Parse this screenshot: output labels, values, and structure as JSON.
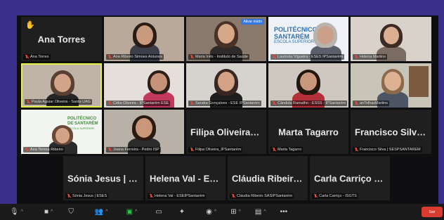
{
  "tiles": [
    {
      "key": "ana",
      "name": "Ana Torres",
      "label": "Ana Torres",
      "raised_hand": true
    },
    {
      "key": "p2",
      "label": "Ana Ribeiro Simoes Antunes"
    },
    {
      "key": "p3",
      "label": "Maria Inês - Instituto de Saúde",
      "tag": "Ativar modo"
    },
    {
      "key": "p4",
      "label": "Laurinda Vigueira - ESES IPSantarém",
      "logo_text": [
        "POLITÉCNICO",
        "SANTARÉM"
      ],
      "logo_small": "ESCOLA SUPERIOR"
    },
    {
      "key": "p5",
      "label": "Helena Martins"
    },
    {
      "key": "p6",
      "label": "Paula Aguiar Oliveira - Santa UAG",
      "active": true
    },
    {
      "key": "p7",
      "label": "Célia Oliveira - IPSantarém ESE"
    },
    {
      "key": "p8",
      "label": "Sandra Gonçalves - ESE IPSantarém"
    },
    {
      "key": "p9",
      "label": "Cândida Ramalho - ESSS - IPSantarém"
    },
    {
      "key": "p10",
      "label": "anTolhasMartins"
    },
    {
      "key": "p11",
      "label": "Ana Teresa Ribeiro",
      "logo_text": [
        "POLITÉCNICO",
        "DE SANTARÉM"
      ],
      "logo_small": "ESCOLA SUPERIOR"
    },
    {
      "key": "p12",
      "label": "Joana Ferreira - Pedro ISP"
    },
    {
      "key": "filipa",
      "name": "Filipa Oliveira_I...",
      "label": "Filipa Oliveira_IPSantarém"
    },
    {
      "key": "marta",
      "name": "Marta Tagarro",
      "label": "Marta Tagarro"
    },
    {
      "key": "francisco",
      "name": "Francisco Silva...",
      "label": "Francisco Silva | SESPSANTAREM"
    },
    {
      "key": "sonia",
      "name": "Sónia Jesus | ESES",
      "label": "Sónia Jesus | ESES"
    },
    {
      "key": "helena",
      "name": "Helena Val - ES...",
      "label": "Helena Val - ESEIPSantarém"
    },
    {
      "key": "claudia",
      "name": "Cláudia Ribeiro...",
      "label": "Cláudia Ribeiro SASIPSantarém"
    },
    {
      "key": "carla",
      "name": "Carla Carriço - E...",
      "label": "Carla Carriço - ISGTS"
    }
  ],
  "toolbar": {
    "end_label": "Sair"
  },
  "colors": {
    "frame": "#3a2f8a",
    "active_border": "#e2f24a",
    "muted_mic": "#e5483b",
    "end_button": "#d83b2f"
  }
}
